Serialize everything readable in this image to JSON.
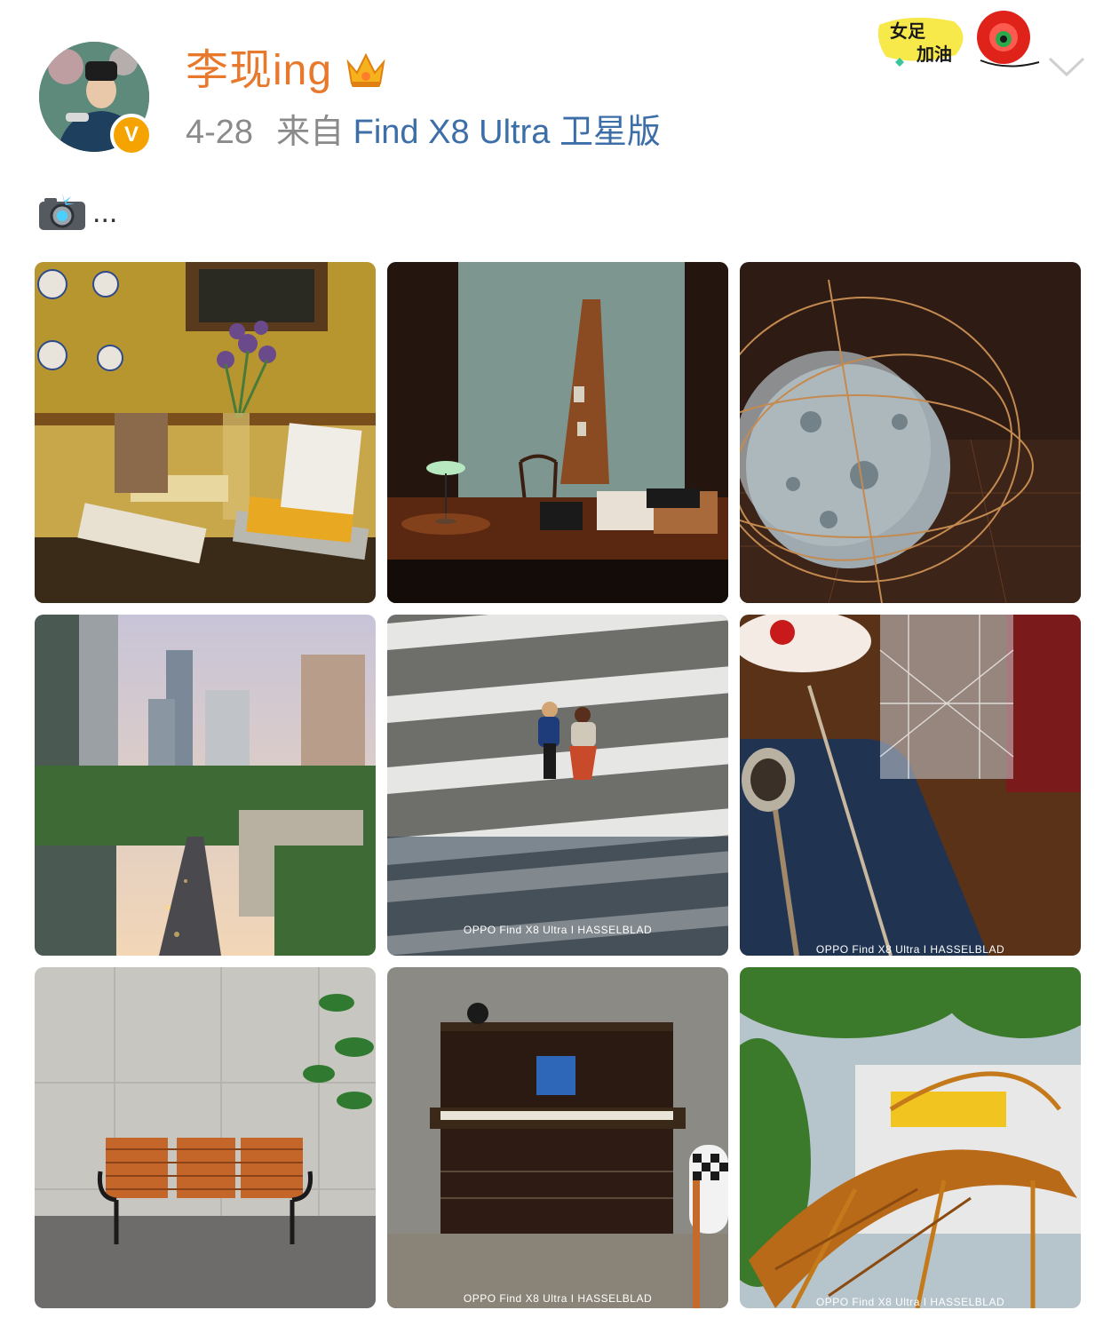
{
  "post": {
    "username": "李现ing",
    "date": "4-28",
    "source_prefix": "来自",
    "source_device": "Find X8 Ultra 卫星版",
    "text": "...",
    "sticker_text": [
      "女足",
      "加油"
    ]
  },
  "photos": [
    {
      "name": "photo-bookshelf-iris",
      "watermark": ""
    },
    {
      "name": "photo-desk-lamp",
      "watermark": ""
    },
    {
      "name": "photo-globe-sphere",
      "watermark": ""
    },
    {
      "name": "photo-city-skyline",
      "watermark": ""
    },
    {
      "name": "photo-crosswalk-couple",
      "watermark": "OPPO Find X8 Ultra I HASSELBLAD"
    },
    {
      "name": "photo-table-glass",
      "watermark": "OPPO Find X8 Ultra I HASSELBLAD"
    },
    {
      "name": "photo-bench-wall",
      "watermark": ""
    },
    {
      "name": "photo-old-piano",
      "watermark": "OPPO Find X8 Ultra I HASSELBLAD"
    },
    {
      "name": "photo-spiral-staircase",
      "watermark": "OPPO Find X8 Ultra I HASSELBLAD"
    }
  ],
  "colors": {
    "username": "#e8792c",
    "source_link": "#3c6ea8",
    "meta": "#8a8a8a",
    "verified_badge": "#f5a300"
  }
}
